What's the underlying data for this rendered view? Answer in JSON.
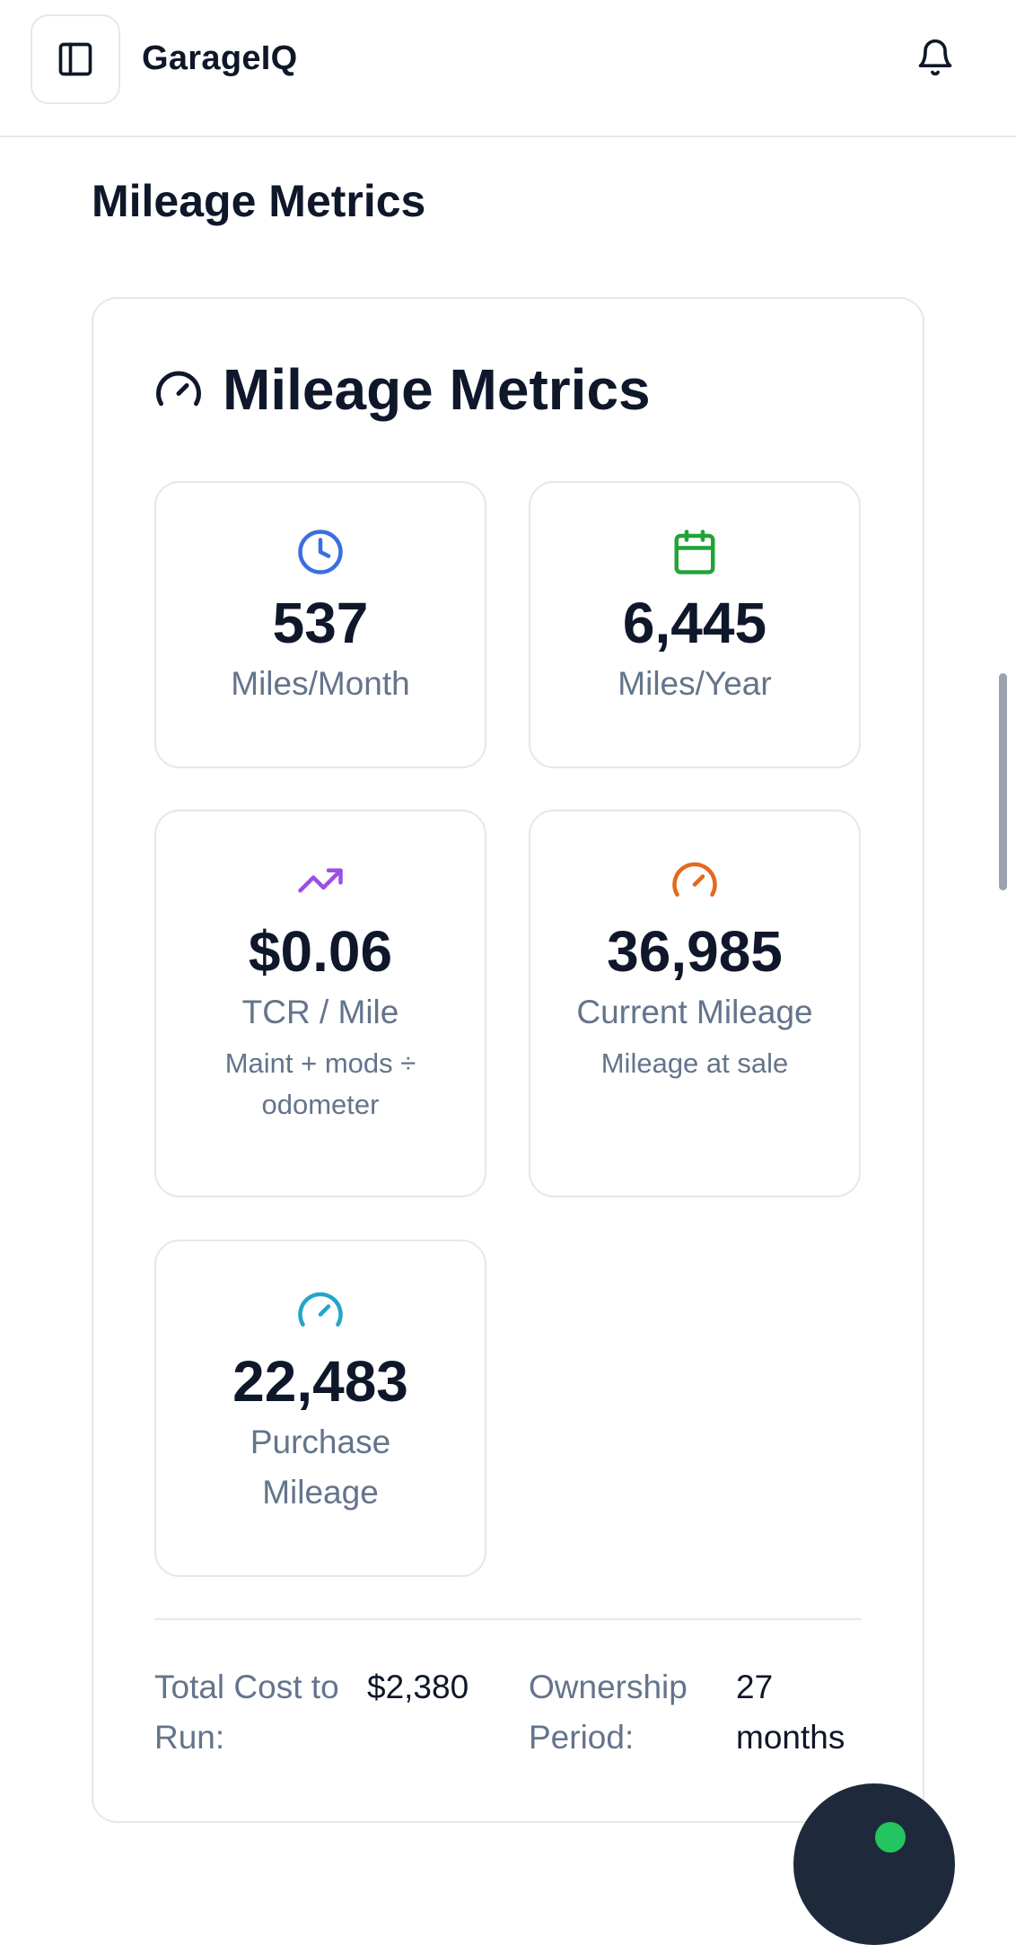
{
  "header": {
    "app_title": "GarageIQ",
    "sidebar_toggle_icon": "sidebar-panel-icon",
    "notification_icon": "bell-icon"
  },
  "page": {
    "title": "Mileage Metrics"
  },
  "card": {
    "title": "Mileage Metrics",
    "title_icon": "gauge-icon",
    "tiles": [
      {
        "icon": "clock-icon",
        "color": "#3b6fe0",
        "value": "537",
        "label": "Miles/Month",
        "sub": ""
      },
      {
        "icon": "calendar-icon",
        "color": "#22a33a",
        "value": "6,445",
        "label": "Miles/Year",
        "sub": ""
      },
      {
        "icon": "trending-up-icon",
        "color": "#9b51e0",
        "value": "$0.06",
        "label": "TCR / Mile",
        "sub": "Maint + mods ÷ odometer"
      },
      {
        "icon": "gauge-icon",
        "color": "#e06a1f",
        "value": "36,985",
        "label": "Current Mileage",
        "sub": "Mileage at sale"
      },
      {
        "icon": "gauge-icon",
        "color": "#25a4c9",
        "value": "22,483",
        "label": "Purchase Mileage",
        "sub": ""
      }
    ],
    "summary": {
      "total_cost_label": "Total Cost to Run:",
      "total_cost_value": "$2,380",
      "ownership_label": "Ownership Period:",
      "ownership_value": "27 months"
    }
  }
}
